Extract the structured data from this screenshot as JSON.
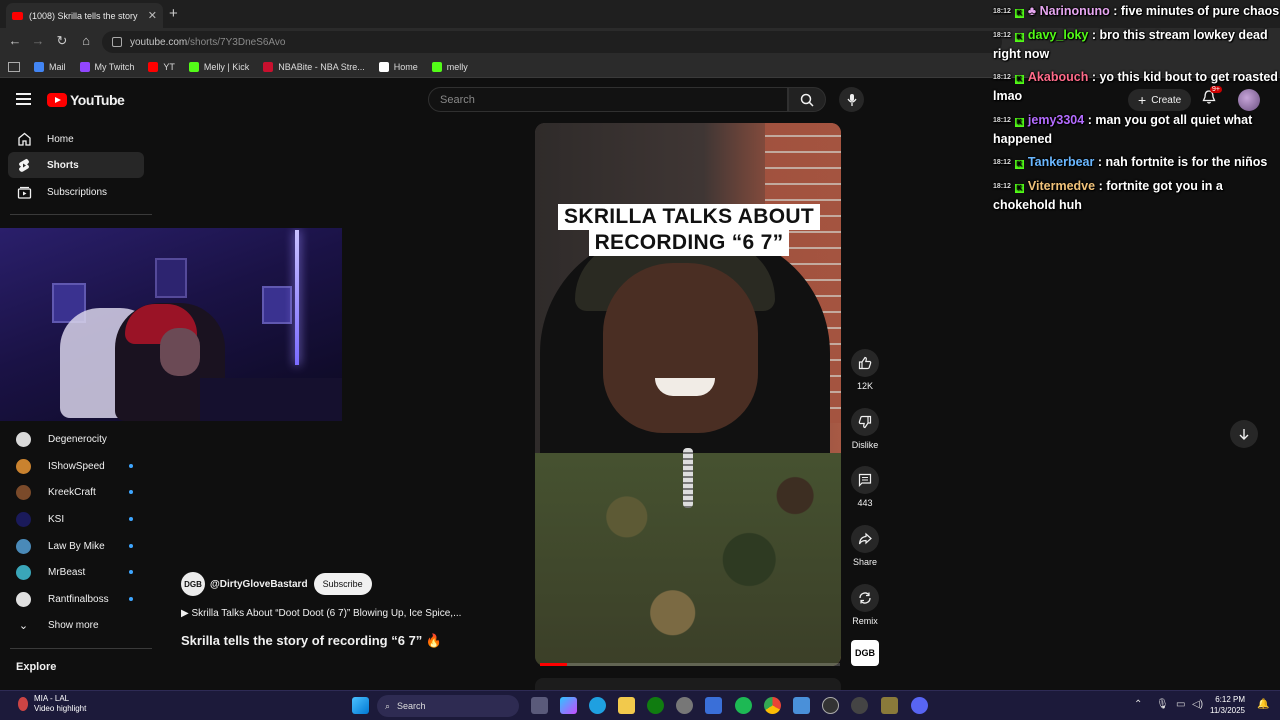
{
  "browser": {
    "tab_title": "(1008) Skrilla tells the story",
    "url_host": "youtube.com",
    "url_path": "/shorts/7Y3DneS6Avo",
    "bookmarks": [
      {
        "label": "Mail",
        "color": "#4285f4"
      },
      {
        "label": "My Twitch",
        "color": "#9146ff"
      },
      {
        "label": "YT",
        "color": "#ff0000"
      },
      {
        "label": "Melly | Kick",
        "color": "#53fc18"
      },
      {
        "label": "NBABite - NBA Stre...",
        "color": "#c8102e"
      },
      {
        "label": "Home",
        "color": "#ffffff"
      },
      {
        "label": "melly",
        "color": "#53fc18"
      }
    ]
  },
  "youtube": {
    "logo_text": "YouTube",
    "search_placeholder": "Search",
    "create_label": "Create",
    "notif_count": "9+"
  },
  "sidebar": {
    "items": [
      {
        "label": "Home",
        "icon": "home-icon"
      },
      {
        "label": "Shorts",
        "icon": "shorts-icon"
      },
      {
        "label": "Subscriptions",
        "icon": "subscriptions-icon"
      }
    ],
    "subscriptions": [
      {
        "label": "Degenerocity",
        "color": "#d9d9d9",
        "dot": false
      },
      {
        "label": "IShowSpeed",
        "color": "#c9822f",
        "dot": true
      },
      {
        "label": "KreekCraft",
        "color": "#7a4a2a",
        "dot": true
      },
      {
        "label": "KSI",
        "color": "#1a1a5a",
        "dot": true
      },
      {
        "label": "Law By Mike",
        "color": "#4a8ab8",
        "dot": true
      },
      {
        "label": "MrBeast",
        "color": "#3aa6b9",
        "dot": true
      },
      {
        "label": "Rantfinalboss",
        "color": "#e0e0e0",
        "dot": true
      }
    ],
    "show_more": "Show more",
    "explore": "Explore"
  },
  "short": {
    "caption_line1": "SKRILLA TALKS ABOUT",
    "caption_line2": "RECORDING “6 7”",
    "progress": 0.09,
    "channel_handle": "@DirtyGloveBastard",
    "channel_badge": "DGB",
    "subscribe_label": "Subscribe",
    "song": "▶ Skrilla Talks About “Doot Doot (6 7)” Blowing Up, Ice Spice,...",
    "title": "Skrilla tells the story of recording “6 7”",
    "likes": "12K",
    "dislike_label": "Dislike",
    "comments": "443",
    "share_label": "Share",
    "remix_label": "Remix"
  },
  "chat": [
    {
      "time": "18:12",
      "user": "Narinonuno",
      "color": "#e6a6f0",
      "text": ": five minutes of pure chaos"
    },
    {
      "time": "18:12",
      "user": "davy_loky",
      "color": "#53fc18",
      "text": ": bro this stream lowkey dead right now"
    },
    {
      "time": "18:12",
      "user": "Akabouch",
      "color": "#ff6b8a",
      "text": ": yo this kid bout to get roasted lmao"
    },
    {
      "time": "18:12",
      "user": "jemy3304",
      "color": "#b46cff",
      "text": ": man you got all quiet what happened"
    },
    {
      "time": "18:12",
      "user": "Tankerbear",
      "color": "#6ab7ff",
      "text": ": nah fortnite is for the niños"
    },
    {
      "time": "18:12",
      "user": "Vitermedve",
      "color": "#f0c27a",
      "text": ": fortnite got you in a chokehold huh"
    }
  ],
  "taskbar": {
    "weather_line1": "MIA - LAL",
    "weather_line2": "Video highlight",
    "search_label": "Search",
    "time": "6:12 PM",
    "date": "11/3/2025"
  }
}
